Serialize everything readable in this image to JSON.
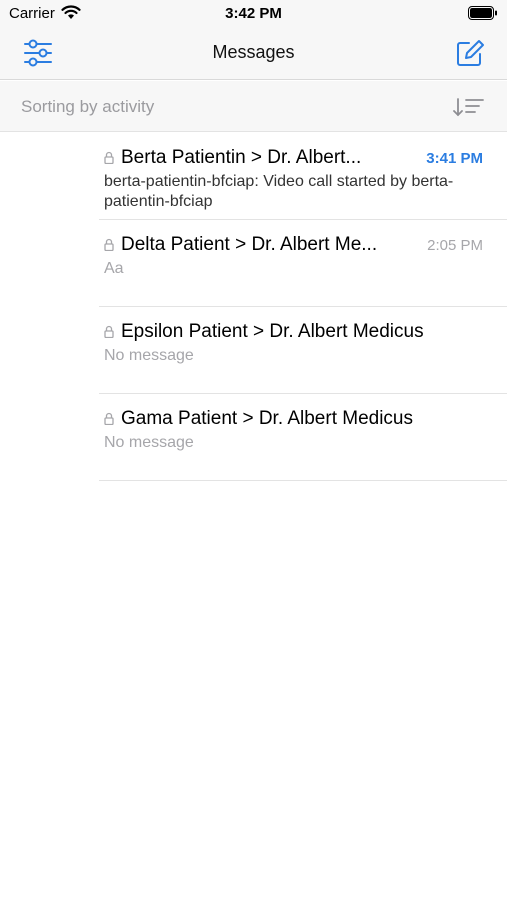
{
  "status_bar": {
    "carrier": "Carrier",
    "time": "3:42 PM"
  },
  "nav": {
    "title": "Messages",
    "left_icon": "filter-sliders-icon",
    "right_icon": "compose-icon",
    "accent_color": "#2b7de1"
  },
  "sort": {
    "label": "Sorting by activity",
    "icon": "sort-icon"
  },
  "conversations": [
    {
      "title": "Berta Patientin > Dr. Albert...",
      "time": "3:41 PM",
      "preview": "berta-patientin-bfciap: Video call started by berta-patientin-bfciap",
      "unread": true
    },
    {
      "title": "Delta Patient > Dr. Albert Me...",
      "time": "2:05 PM",
      "preview": "Aa",
      "unread": false
    },
    {
      "title": "Epsilon Patient > Dr. Albert Medicus",
      "time": "",
      "preview": "No message",
      "unread": false
    },
    {
      "title": "Gama Patient > Dr. Albert Medicus",
      "time": "",
      "preview": "No message",
      "unread": false
    }
  ]
}
